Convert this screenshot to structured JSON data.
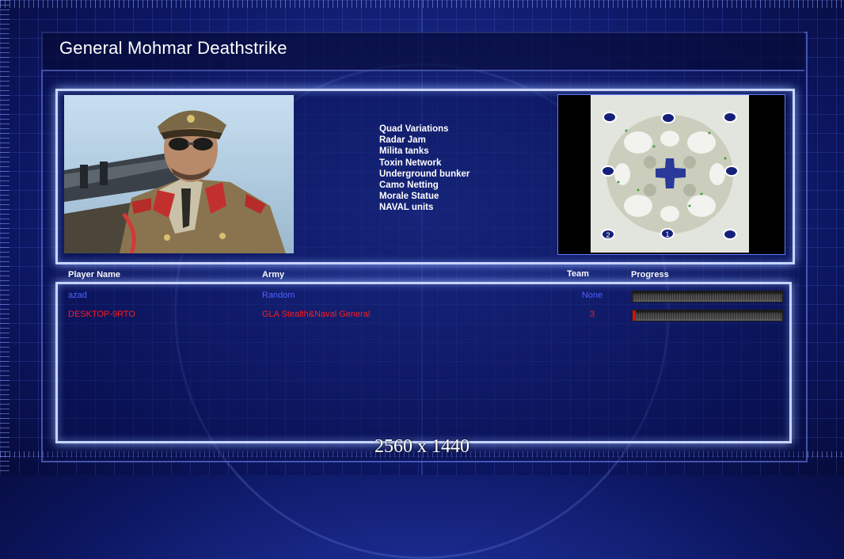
{
  "title": "General Mohmar Deathstrike",
  "features": [
    "Quad Variations",
    "Radar Jam",
    "Milita tanks",
    "Toxin Network",
    "Underground bunker",
    "Camo Netting",
    "Morale Statue",
    "NAVAL units"
  ],
  "columns": {
    "player": "Player Name",
    "army": "Army",
    "team": "Team",
    "progress": "Progress"
  },
  "players": [
    {
      "name": "azad",
      "army": "Random",
      "team": "None",
      "progress": 0,
      "color": "#4a62ff"
    },
    {
      "name": "DESKTOP-9RTO",
      "army": "GLA Stealth&Naval General",
      "team": "3",
      "progress": 0.02,
      "color": "#ff1a1a"
    }
  ],
  "minimap": {
    "start_labels": [
      "2",
      "1"
    ]
  },
  "resolution": "2560 x 1440"
}
